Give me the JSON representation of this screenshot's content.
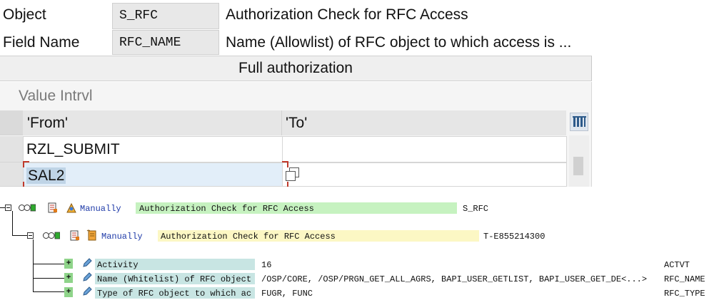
{
  "header": {
    "object_label": "Object",
    "object_value": "S_RFC",
    "object_desc": "Authorization Check for RFC Access",
    "field_label": "Field Name",
    "field_value": "RFC_NAME",
    "field_desc": "Name (Allowlist) of RFC object to which access is ..."
  },
  "full_auth_button": "Full authorization",
  "value_interval": {
    "title": "Value Intrvl",
    "col_from": "'From'",
    "col_to": "'To'",
    "rows": [
      {
        "from": "RZL_SUBMIT",
        "to": ""
      },
      {
        "from": "SAL2",
        "to": ""
      }
    ]
  },
  "tree": {
    "root": {
      "status": "Manually",
      "text": "Authorization Check for RFC Access",
      "object": "S_RFC"
    },
    "child": {
      "status": "Manually",
      "text": "Authorization Check for RFC Access",
      "object": "T-E855214300"
    },
    "fields": [
      {
        "name": "Activity",
        "value": "16",
        "tech": "ACTVT"
      },
      {
        "name": "Name (Whitelist) of RFC object",
        "value": "/OSP/CORE, /OSP/PRGN_GET_ALL_AGRS, BAPI_USER_GETLIST, BAPI_USER_GET_DE<...>",
        "tech": "RFC_NAME"
      },
      {
        "name": "Type of RFC object to which ac",
        "value": "FUGR, FUNC",
        "tech": "RFC_TYPE"
      }
    ],
    "plus_symbol": "+"
  },
  "colors": {
    "green_band": "#c6f2c0",
    "yellow_band": "#fcf7c4",
    "teal_band": "#c8e5e3",
    "status_blue": "#1e3aa8"
  }
}
